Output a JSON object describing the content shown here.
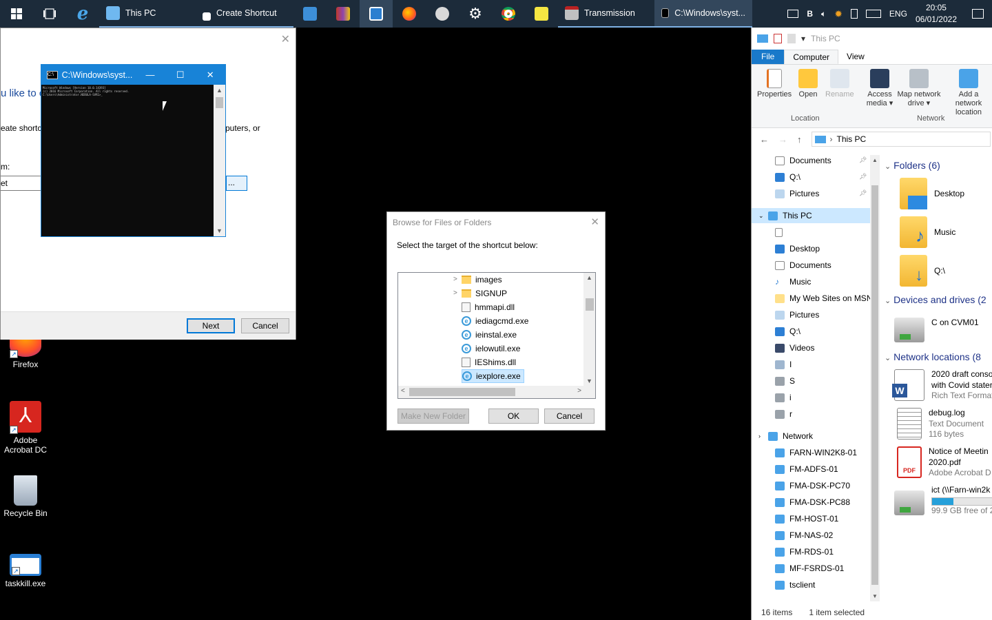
{
  "taskbar": {
    "apps": [
      {
        "label": "This PC"
      },
      {
        "label": "Create Shortcut"
      },
      {
        "label": "Transmission"
      },
      {
        "label": "C:\\Windows\\syst..."
      }
    ],
    "tray": {
      "letter": "B",
      "language": "ENG",
      "time": "20:05",
      "date": "06/01/2022"
    }
  },
  "desktop": {
    "icons": [
      {
        "label": "Firefox"
      },
      {
        "label": "Adobe Acrobat DC"
      },
      {
        "label": "Recycle Bin"
      },
      {
        "label": "taskkill.exe"
      }
    ]
  },
  "wizard": {
    "question": "u like to c",
    "text_left": "eate shortcu",
    "text_right": "puters, or",
    "field_label": "m:",
    "location_value": "et",
    "browse_label": "...",
    "next_label": "Next",
    "cancel_label": "Cancel"
  },
  "console": {
    "title": "C:\\Windows\\syst...",
    "lines": [
      "Microsoft Windows [Version 10.0.14393]",
      "(c) 2016 Microsoft Corporation. All rights reserved.",
      "",
      "C:\\Users\\Administrator.NEBULA-SVR1>_"
    ]
  },
  "browse_dialog": {
    "title": "Browse for Files or Folders",
    "prompt": "Select the target of the shortcut below:",
    "items": [
      {
        "label": "images",
        "type": "folder"
      },
      {
        "label": "SIGNUP",
        "type": "folder"
      },
      {
        "label": "hmmapi.dll",
        "type": "file"
      },
      {
        "label": "iediagcmd.exe",
        "type": "ie"
      },
      {
        "label": "ieinstal.exe",
        "type": "ie"
      },
      {
        "label": "ielowutil.exe",
        "type": "ie"
      },
      {
        "label": "IEShims.dll",
        "type": "file"
      },
      {
        "label": "iexplore.exe",
        "type": "ie",
        "selected": true
      }
    ],
    "new_folder_label": "Make New Folder",
    "ok_label": "OK",
    "cancel_label": "Cancel"
  },
  "explorer": {
    "title": "This PC",
    "tabs": {
      "file": "File",
      "computer": "Computer",
      "view": "View"
    },
    "ribbon": {
      "properties": "Properties",
      "open": "Open",
      "rename": "Rename",
      "access_media": "Access media ▾",
      "map_drive": "Map network drive ▾",
      "add_location": "Add a network location",
      "group_location": "Location",
      "group_network": "Network"
    },
    "address": "This PC",
    "nav": {
      "quick": [
        {
          "label": "Documents"
        },
        {
          "label": "Q:\\"
        },
        {
          "label": "Pictures"
        }
      ],
      "this_pc": "This PC",
      "pc_items": [
        {
          "label": ""
        },
        {
          "label": "Desktop"
        },
        {
          "label": "Documents"
        },
        {
          "label": "Music"
        },
        {
          "label": "My Web Sites on MSN"
        },
        {
          "label": "Pictures"
        },
        {
          "label": "Q:\\"
        },
        {
          "label": "Videos"
        },
        {
          "label": "I"
        },
        {
          "label": "S"
        },
        {
          "label": "i"
        },
        {
          "label": "r"
        }
      ],
      "network": "Network",
      "network_items": [
        {
          "label": "FARN-WIN2K8-01"
        },
        {
          "label": "FM-ADFS-01"
        },
        {
          "label": "FMA-DSK-PC70"
        },
        {
          "label": "FMA-DSK-PC88"
        },
        {
          "label": "FM-HOST-01"
        },
        {
          "label": "FM-NAS-02"
        },
        {
          "label": "FM-RDS-01"
        },
        {
          "label": "MF-FSRDS-01"
        },
        {
          "label": "tsclient"
        }
      ]
    },
    "content": {
      "folders_header": "Folders (6)",
      "folders": [
        {
          "label": "Desktop"
        },
        {
          "label": "Music"
        },
        {
          "label": "Q:\\"
        }
      ],
      "devices_header": "Devices and drives (2",
      "drive": "C on CVM01",
      "network_header": "Network locations (8",
      "net1_l1": "2020 draft conso",
      "net1_l2": "with Covid stater",
      "net1_l3": "Rich Text Format",
      "net2_l1": "debug.log",
      "net2_l2": "Text Document",
      "net2_l3": "116 bytes",
      "net3_l1": "Notice of Meetin",
      "net3_l2": "2020.pdf",
      "net3_l3": "Adobe Acrobat D",
      "net4_l1": "ict (\\\\Farn-win2k",
      "net4_l3": "99.9 GB free of 2",
      "drive_used": 0.35
    },
    "status": {
      "count": "16 items",
      "selected": "1 item selected"
    }
  }
}
